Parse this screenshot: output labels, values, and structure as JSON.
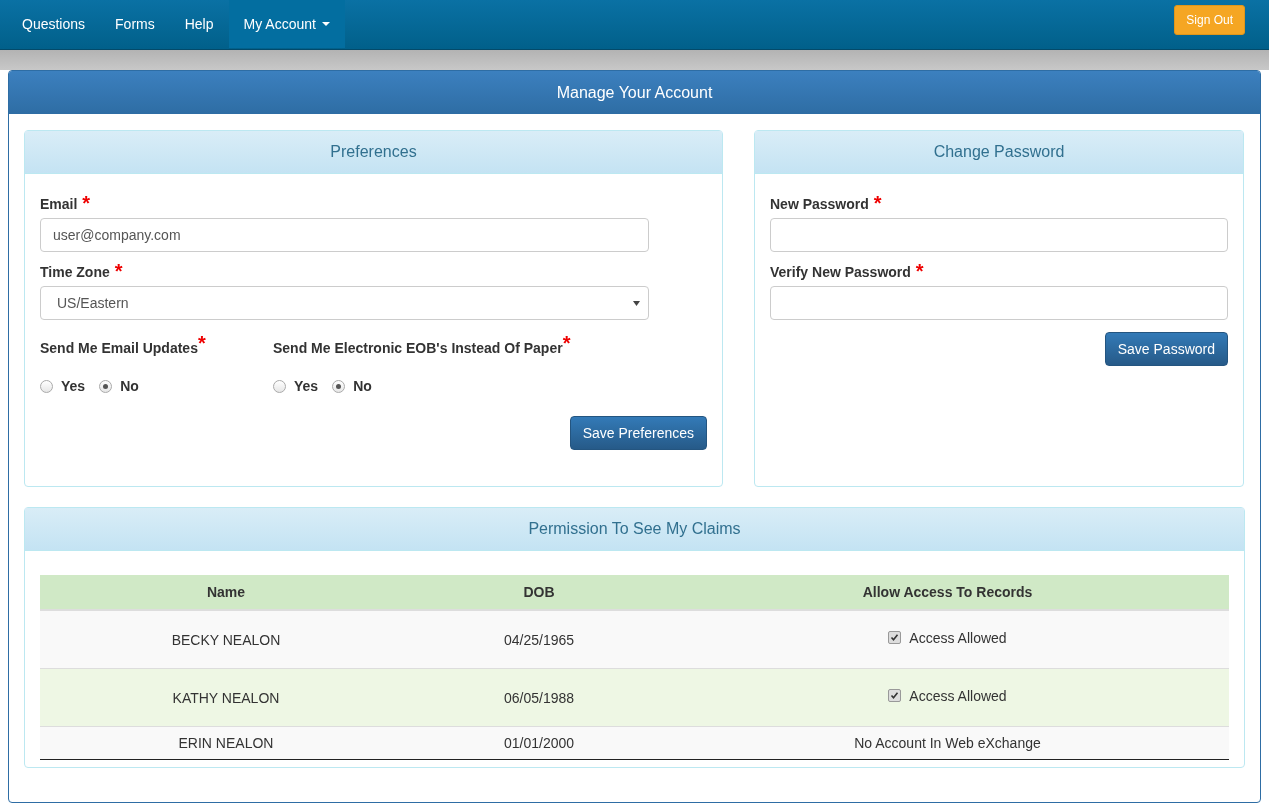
{
  "nav": {
    "items": [
      {
        "label": "Questions",
        "selected": false,
        "dropdown": false
      },
      {
        "label": "Forms",
        "selected": false,
        "dropdown": false
      },
      {
        "label": "Help",
        "selected": false,
        "dropdown": false
      },
      {
        "label": "My Account",
        "selected": true,
        "dropdown": true
      }
    ],
    "sign_out": "Sign Out"
  },
  "page_title": "Manage Your Account",
  "preferences": {
    "title": "Preferences",
    "email": {
      "label": "Email",
      "required_mark": "*",
      "value": "user@company.com"
    },
    "time_zone": {
      "label": "Time Zone",
      "required_mark": "*",
      "value": "US/Eastern"
    },
    "radio_groups": [
      {
        "label": "Send Me Email Updates",
        "required_mark": "*",
        "options": [
          {
            "label": "Yes",
            "selected": false
          },
          {
            "label": "No",
            "selected": true
          }
        ]
      },
      {
        "label": "Send Me Electronic EOB's Instead Of Paper",
        "required_mark": "*",
        "options": [
          {
            "label": "Yes",
            "selected": false
          },
          {
            "label": "No",
            "selected": true
          }
        ]
      }
    ],
    "save": "Save Preferences"
  },
  "change_password": {
    "title": "Change Password",
    "fields": [
      {
        "label": "New Password",
        "required_mark": "*"
      },
      {
        "label": "Verify New Password",
        "required_mark": "*"
      }
    ],
    "save": "Save Password"
  },
  "permissions": {
    "title": "Permission To See My Claims",
    "columns": [
      "Name",
      "DOB",
      "Allow Access To Records"
    ],
    "rows": [
      {
        "name": "BECKY NEALON",
        "dob": "04/25/1965",
        "access": {
          "kind": "checkbox",
          "checked": true,
          "label": "Access Allowed"
        }
      },
      {
        "name": "KATHY NEALON",
        "dob": "06/05/1988",
        "access": {
          "kind": "checkbox",
          "checked": true,
          "label": "Access Allowed"
        }
      },
      {
        "name": "ERIN NEALON",
        "dob": "01/01/2000",
        "access": {
          "kind": "text",
          "label": "No Account In Web eXchange"
        }
      }
    ]
  }
}
